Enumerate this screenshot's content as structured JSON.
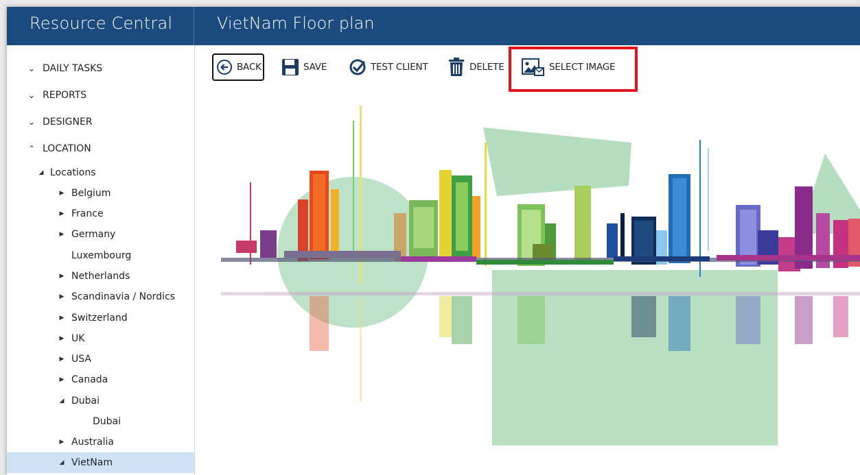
{
  "app": {
    "title": "Resource Central"
  },
  "page": {
    "title": "VietNam Floor plan"
  },
  "sidebar": {
    "sections": [
      {
        "label": "DAILY TASKS",
        "expanded": false
      },
      {
        "label": "REPORTS",
        "expanded": false
      },
      {
        "label": "DESIGNER",
        "expanded": false
      },
      {
        "label": "LOCATION",
        "expanded": true
      }
    ],
    "tree": {
      "root": "Locations",
      "items": [
        {
          "label": "Belgium",
          "state": "collapsed"
        },
        {
          "label": "France",
          "state": "collapsed"
        },
        {
          "label": "Germany",
          "state": "collapsed"
        },
        {
          "label": "Luxembourg",
          "state": "leaf"
        },
        {
          "label": "Netherlands",
          "state": "collapsed"
        },
        {
          "label": "Scandinavia / Nordics",
          "state": "collapsed"
        },
        {
          "label": "Switzerland",
          "state": "collapsed"
        },
        {
          "label": "UK",
          "state": "collapsed"
        },
        {
          "label": "USA",
          "state": "collapsed"
        },
        {
          "label": "Canada",
          "state": "collapsed"
        },
        {
          "label": "Dubai",
          "state": "expanded"
        },
        {
          "label": "Dubai",
          "state": "child"
        },
        {
          "label": "Australia",
          "state": "collapsed"
        },
        {
          "label": "VietNam",
          "state": "expanded",
          "selected": true
        }
      ]
    }
  },
  "toolbar": {
    "back_label": "BACK",
    "save_label": "SAVE",
    "test_client_label": "TEST CLIENT",
    "delete_label": "DELETE",
    "select_image_label": "SELECT IMAGE"
  },
  "icons": {
    "chevron_down": "chevron-down-icon",
    "chevron_up": "chevron-up-icon",
    "tree_expanded": "triangle-down-icon",
    "tree_collapsed": "triangle-right-icon"
  },
  "colors": {
    "header_bg": "#1b4a7e",
    "selected_bg": "#cde3f5",
    "highlight": "#e3141f"
  }
}
